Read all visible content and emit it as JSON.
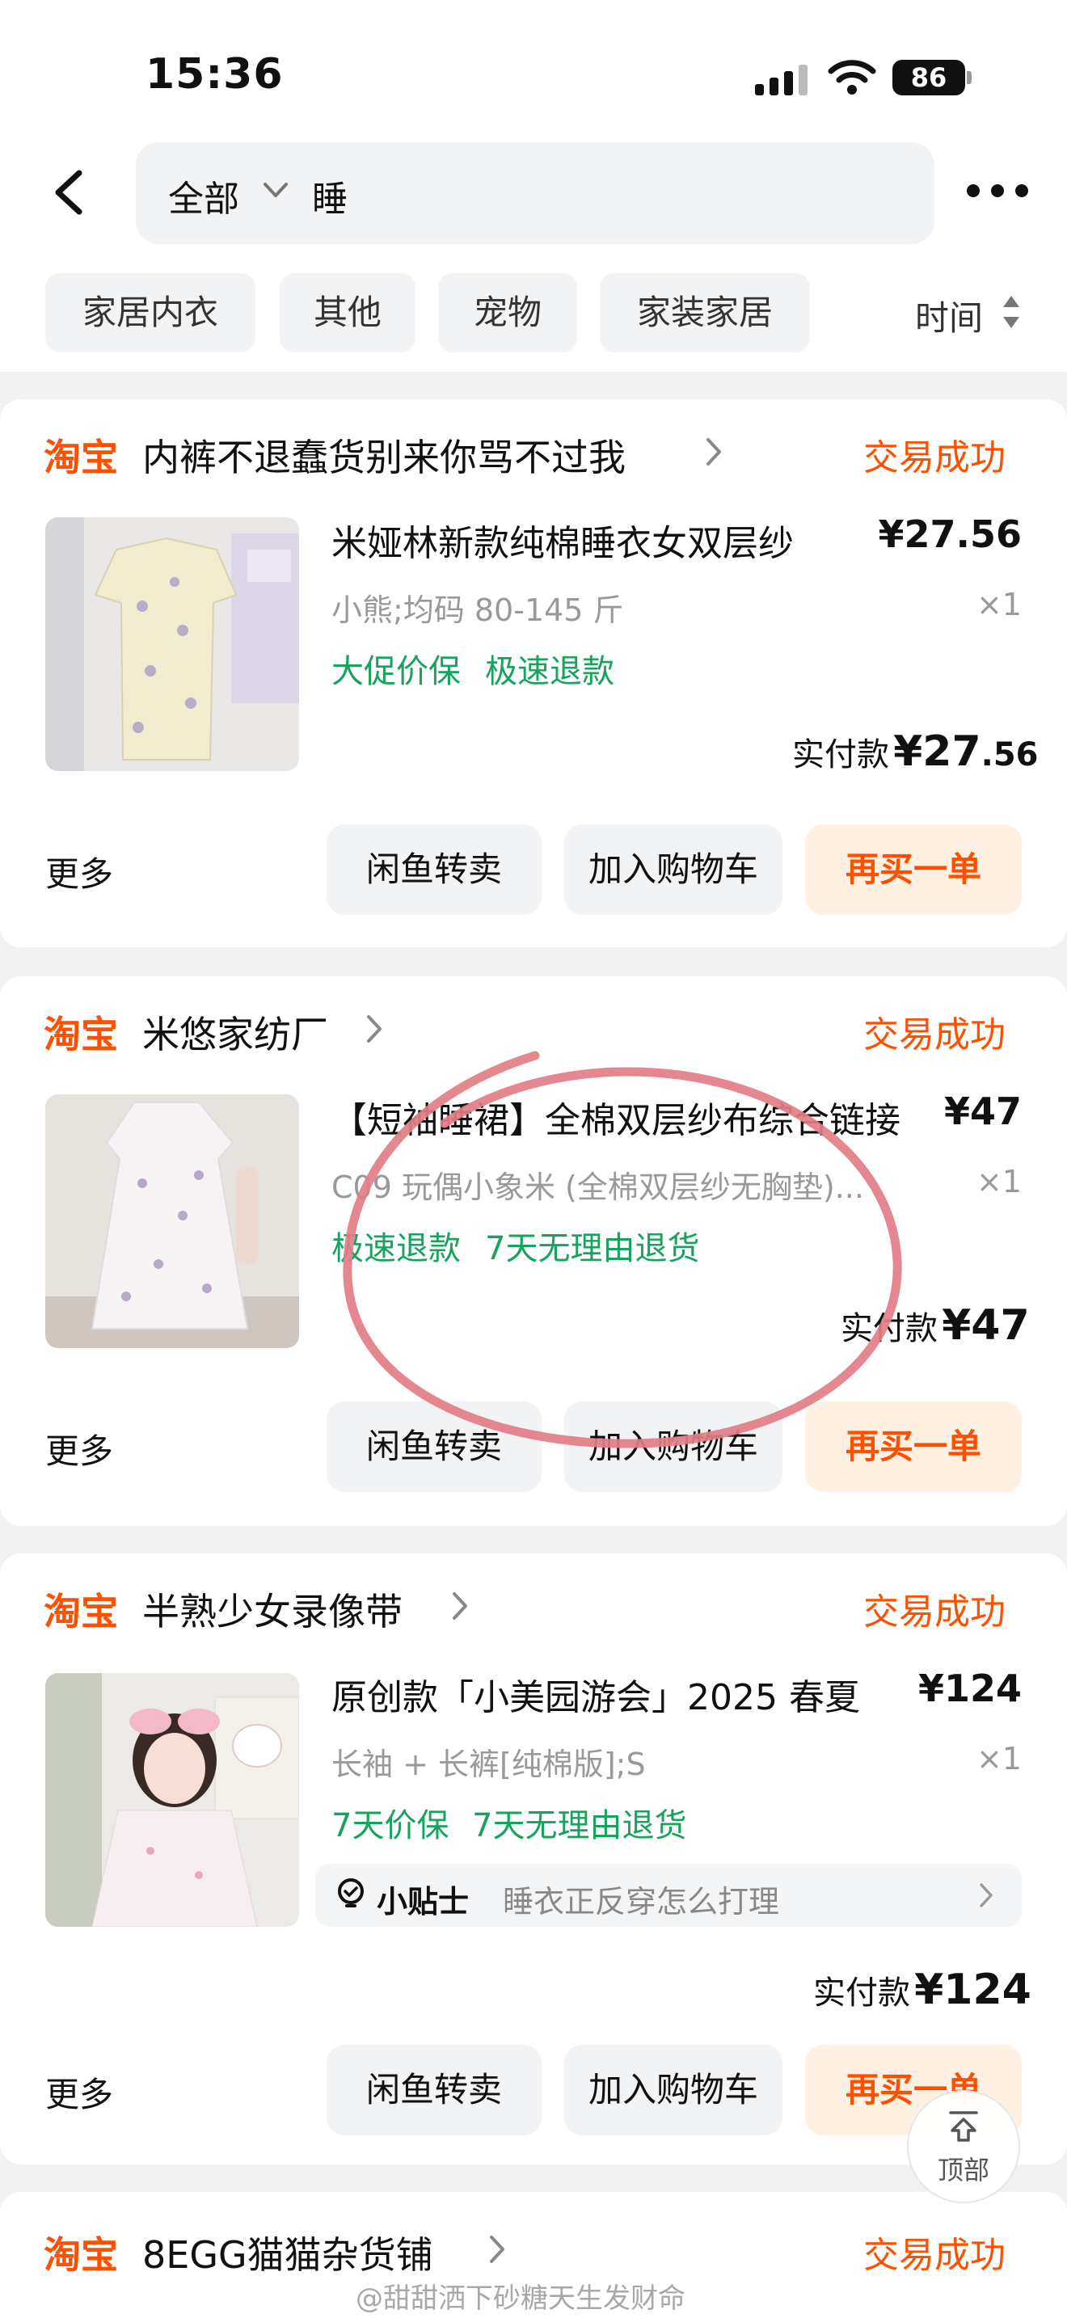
{
  "status_bar": {
    "time": "15:36",
    "battery": "86"
  },
  "header": {
    "scope": "全部",
    "query": "睡",
    "filters": [
      "家居内衣",
      "其他",
      "宠物",
      "家装家居"
    ],
    "sort_label": "时间"
  },
  "logo_text": "淘宝",
  "orders": [
    {
      "shop": "内裤不退蠢货别来你骂不过我",
      "status": "交易成功",
      "title": "米娅林新款纯棉睡衣女双层纱",
      "price": "¥27.56",
      "spec": "小熊;均码 80-145 斤",
      "qty": "×1",
      "tags": [
        "大促价保",
        "极速退款"
      ],
      "paid_label": "实付款",
      "paid_main": "¥27",
      "paid_cents": ".56",
      "more": "更多",
      "buttons": [
        "闲鱼转卖",
        "加入购物车",
        "再买一单"
      ]
    },
    {
      "shop": "米悠家纺厂",
      "status": "交易成功",
      "title": "【短袖睡裙】全棉双层纱布综合链接",
      "price": "¥47",
      "spec": "C09 玩偶小象米 (全棉双层纱无胸垫)...",
      "qty": "×1",
      "tags": [
        "极速退款",
        "7天无理由退货"
      ],
      "paid_label": "实付款",
      "paid_main": "¥47",
      "more": "更多",
      "buttons": [
        "闲鱼转卖",
        "加入购物车",
        "再买一单"
      ]
    },
    {
      "shop": "半熟少女录像带",
      "status": "交易成功",
      "title": "原创款「小美园游会」2025 春夏",
      "price": "¥124",
      "spec": "长袖 + 长裤[纯棉版];S",
      "qty": "×1",
      "tags": [
        "7天价保",
        "7天无理由退货"
      ],
      "tip_label": "小贴士",
      "tip_text": "睡衣正反穿怎么打理",
      "paid_label": "实付款",
      "paid_main": "¥124",
      "more": "更多",
      "buttons": [
        "闲鱼转卖",
        "加入购物车",
        "再买一单"
      ]
    },
    {
      "shop": "8EGG猫猫杂货铺",
      "status": "交易成功"
    }
  ],
  "back_to_top": "顶部",
  "watermark": "@甜甜洒下砂糖天生发财命",
  "colors": {
    "brand": "#ff5000",
    "tag_green": "#17a35b",
    "annotation": "#e27d86"
  }
}
